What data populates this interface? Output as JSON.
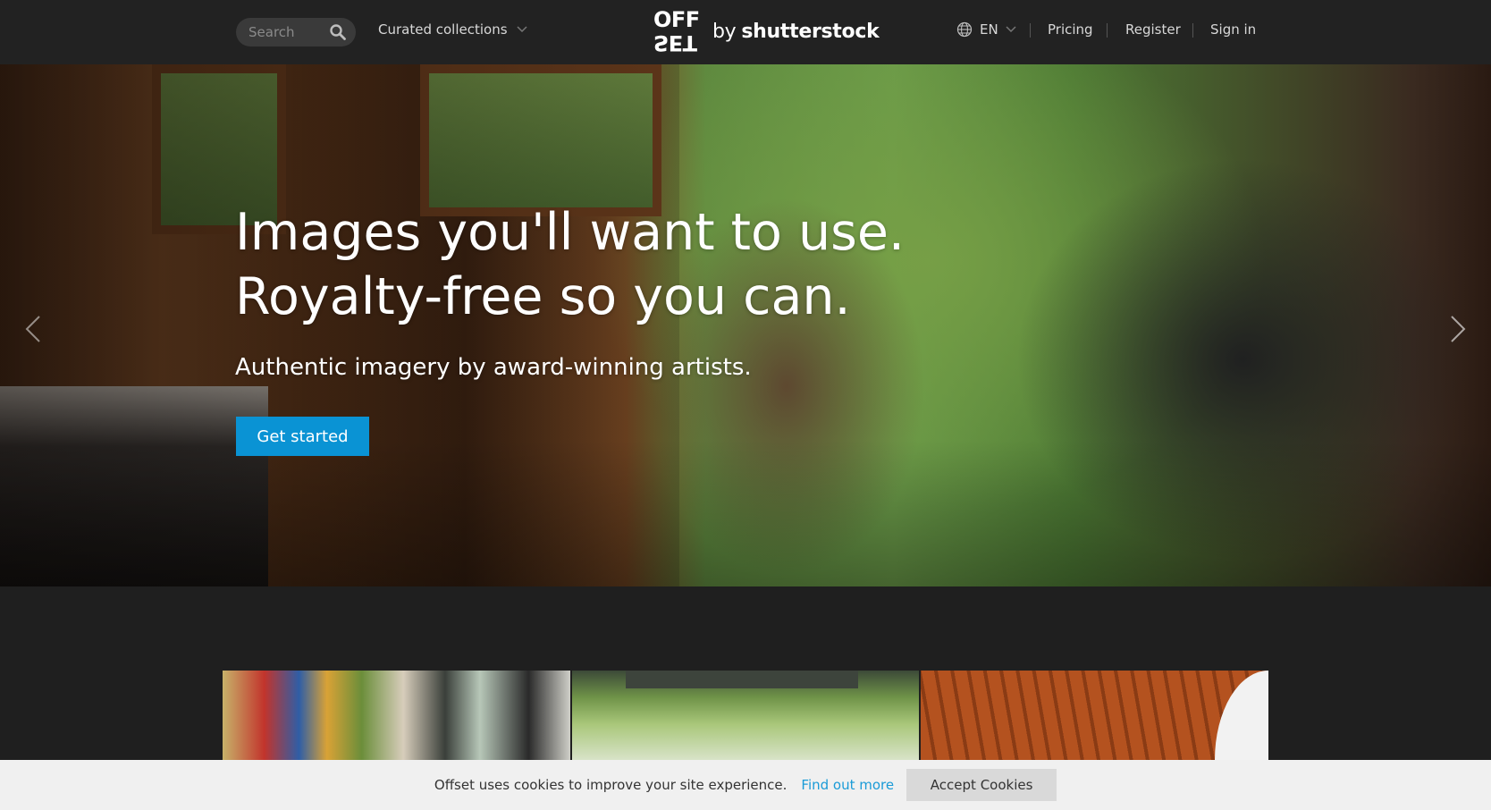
{
  "header": {
    "search_placeholder": "Search",
    "curated_label": "Curated collections",
    "logo_mark_top": "OFF",
    "logo_mark_bottom": "SET",
    "logo_by": "by",
    "logo_brand": "shutterstock",
    "lang_label": "EN",
    "pricing": "Pricing",
    "register": "Register",
    "sign_in": "Sign in"
  },
  "hero": {
    "title_line1": "Images you'll want to use.",
    "title_line2": "Royalty-free so you can.",
    "subtitle": "Authentic imagery by award-winning artists.",
    "cta": "Get started"
  },
  "cookie": {
    "text": "Offset uses cookies to improve your site experience.",
    "link": "Find out more",
    "button": "Accept Cookies"
  },
  "colors": {
    "header_bg": "#222222",
    "accent": "#0a93d4",
    "link": "#1a9bd7"
  },
  "icons": [
    "search-icon",
    "chevron-down-icon",
    "globe-icon",
    "arrow-left-icon",
    "arrow-right-icon"
  ]
}
